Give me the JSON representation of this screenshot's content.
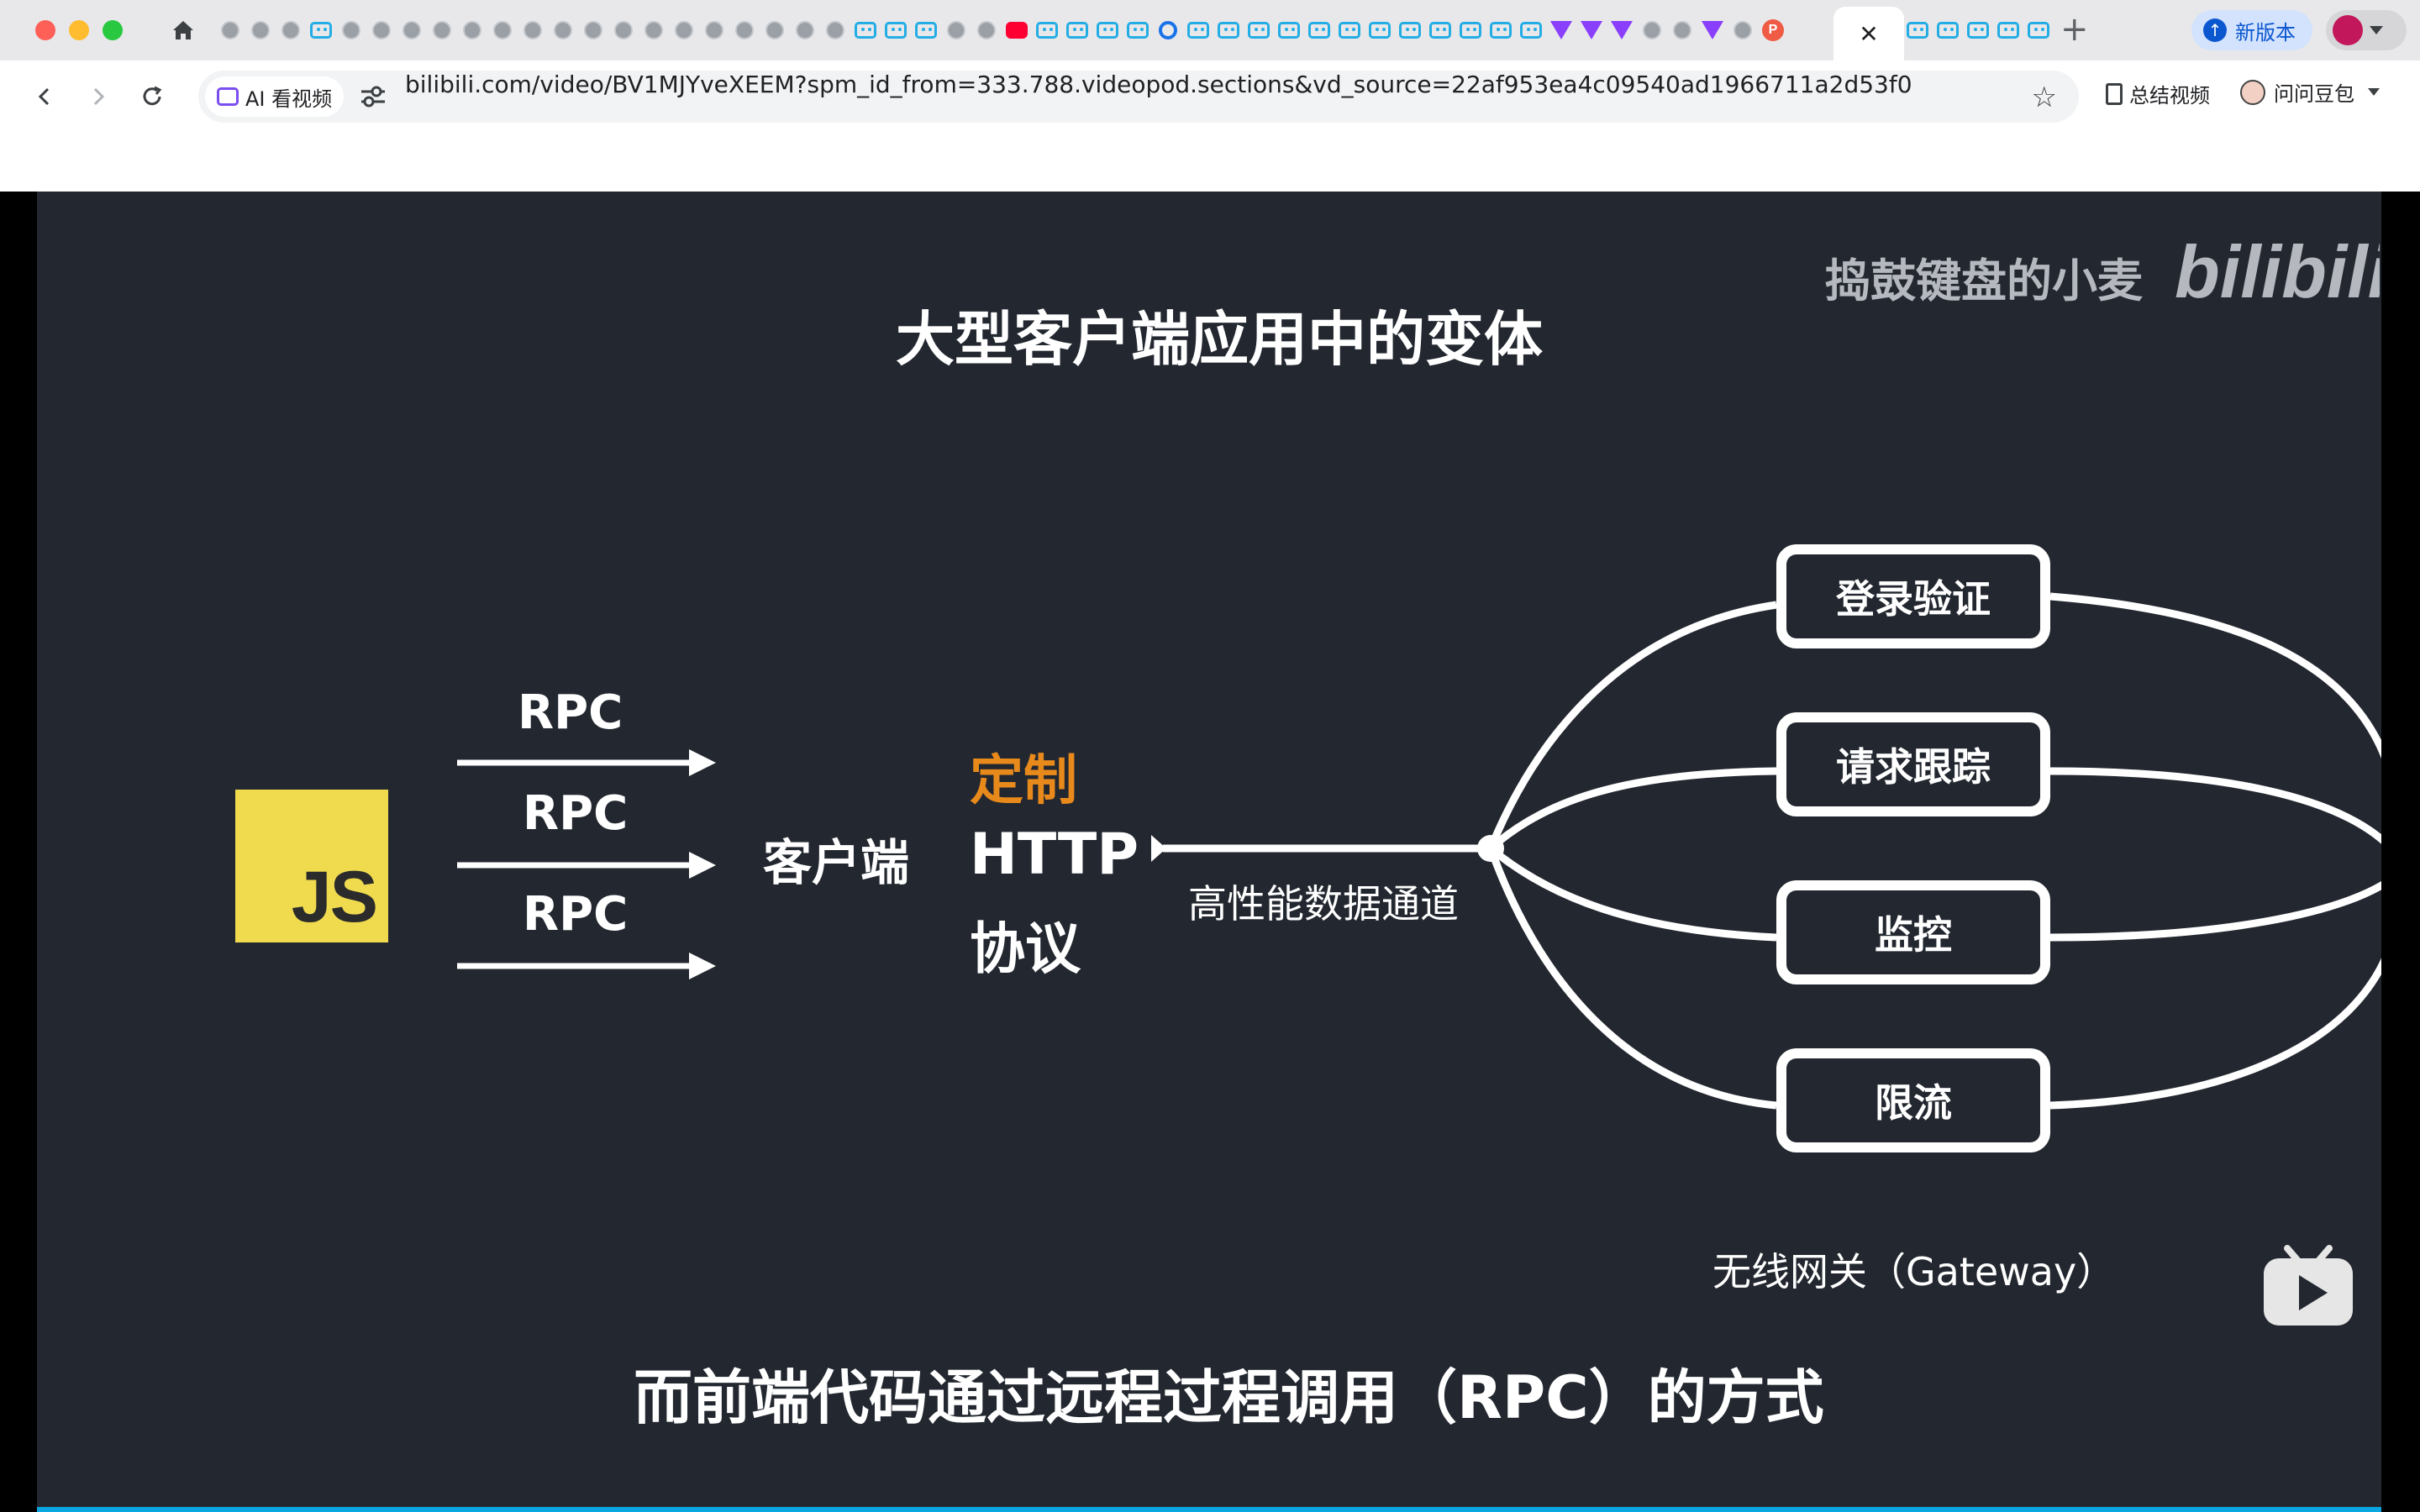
{
  "browser": {
    "active_tab_close": "✕",
    "new_tab": "+",
    "update_label": "新版本",
    "address": {
      "ai_chip_label": "AI 看视频",
      "url": "bilibili.com/video/BV1MJYveXEEM?spm_id_from=333.788.videopod.sections&vd_source=22af953ea4c09540ad1966711a2d53f0"
    },
    "summary_label": "总结视频",
    "doubao_label": "问问豆包",
    "pinned_tabs_left": [
      "g",
      "g",
      "g",
      "bili",
      "g",
      "g",
      "g",
      "g",
      "g",
      "g",
      "g",
      "g",
      "g",
      "g",
      "g",
      "g",
      "g",
      "g",
      "g",
      "g",
      "g",
      "bili",
      "bili",
      "bili",
      "g",
      "g",
      "yt",
      "bili",
      "bili",
      "bili",
      "bili",
      "sq",
      "bili",
      "bili",
      "bili",
      "bili",
      "bili",
      "bili",
      "bili",
      "bili",
      "bili",
      "bili",
      "bili",
      "bili",
      "vt",
      "vt",
      "vt",
      "g",
      "g",
      "vt",
      "g",
      "pp"
    ],
    "pinned_tabs_right": [
      "bili",
      "bili",
      "bili",
      "bili",
      "bili"
    ]
  },
  "slide": {
    "title": "大型客户端应用中的变体",
    "watermark": "捣鼓键盘的小麦",
    "watermark_logo": "bilibili",
    "js_logo": "JS",
    "rpc_labels": [
      "RPC",
      "RPC",
      "RPC"
    ],
    "client_label": "客户端",
    "custom_label": "定制",
    "http_label": "HTTP",
    "protocol_label": "协议",
    "channel_label": "高性能数据通道",
    "gateway_boxes": [
      "登录验证",
      "请求跟踪",
      "监控",
      "限流"
    ],
    "gateway_label": "无线网关（Gateway）",
    "subtitle": "而前端代码通过远程过程调用（RPC）的方式"
  },
  "colors": {
    "slide_bg": "#232830",
    "accent_orange": "#e8891b",
    "js_yellow": "#f0db4f",
    "progress_blue": "#0aa6e0"
  }
}
